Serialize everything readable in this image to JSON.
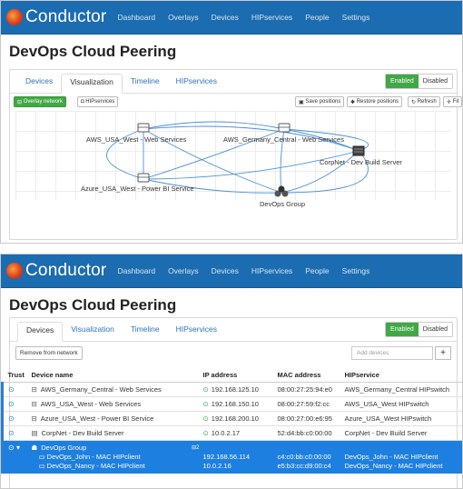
{
  "brand": "Conductor",
  "nav": [
    "Dashboard",
    "Overlays",
    "Devices",
    "HIPservices",
    "People",
    "Settings"
  ],
  "page_title": "DevOps Cloud Peering",
  "tabs": [
    "Devices",
    "Visualization",
    "Timeline",
    "HIPservices"
  ],
  "toggle": {
    "enabled": "Enabled",
    "disabled": "Disabled"
  },
  "viz_toolbar": {
    "overlay_network": "Overlay network",
    "hipservices": "HIPservices",
    "save_positions": "Save positions",
    "restore_positions": "Restore positions",
    "refresh": "Refresh",
    "fit": "Fit"
  },
  "nodes": [
    {
      "label": "AWS_USA_West - Web Services"
    },
    {
      "label": "AWS_Germany_Central - Web Services"
    },
    {
      "label": "CorpNet - Dev Build Server"
    },
    {
      "label": "Azure_USA_West - Power BI Service"
    },
    {
      "label": "DevOps Group"
    }
  ],
  "devices": {
    "remove_btn": "Remove from network",
    "add_placeholder": "Add devices",
    "add_btn": "+",
    "columns": [
      "Trust",
      "Device name",
      "IP address",
      "MAC address",
      "HIPservice"
    ],
    "rows": [
      {
        "name": "AWS_Germany_Central - Web Services",
        "ip": "192.168.125.10",
        "mac": "08:00:27:25:94:e0",
        "hip": "AWS_Germany_Central HIPswitch"
      },
      {
        "name": "AWS_USA_West - Web Services",
        "ip": "192.168.150.10",
        "mac": "08:00:27:59:f2:cc",
        "hip": "AWS_USA_West HIPswitch"
      },
      {
        "name": "Azure_USA_West - Power BI Service",
        "ip": "192.168.200.10",
        "mac": "08:00:27:00:e6:95",
        "hip": "Azure_USA_West HIPswitch"
      },
      {
        "name": "CorpNet - Dev Build Server",
        "ip": "10.0.2.17",
        "mac": "52:d4:bb:c0:00:00",
        "hip": "CorpNet - Dev Build Server"
      }
    ],
    "group": {
      "name": "DevOps Group",
      "count": "2",
      "members": [
        {
          "name": "DevOps_John - MAC HIPclient",
          "ip": "192.168.56.114",
          "mac": "c4:c0:bb:c0:00:00",
          "hip": "DevOps_John - MAC HIPclient"
        },
        {
          "name": "DevOps_Nancy - MAC HIPclient",
          "ip": "10.0.2.16",
          "mac": "e5:b3:cc:d9:00:c4",
          "hip": "DevOps_Nancy - MAC HIPclient"
        }
      ]
    }
  }
}
